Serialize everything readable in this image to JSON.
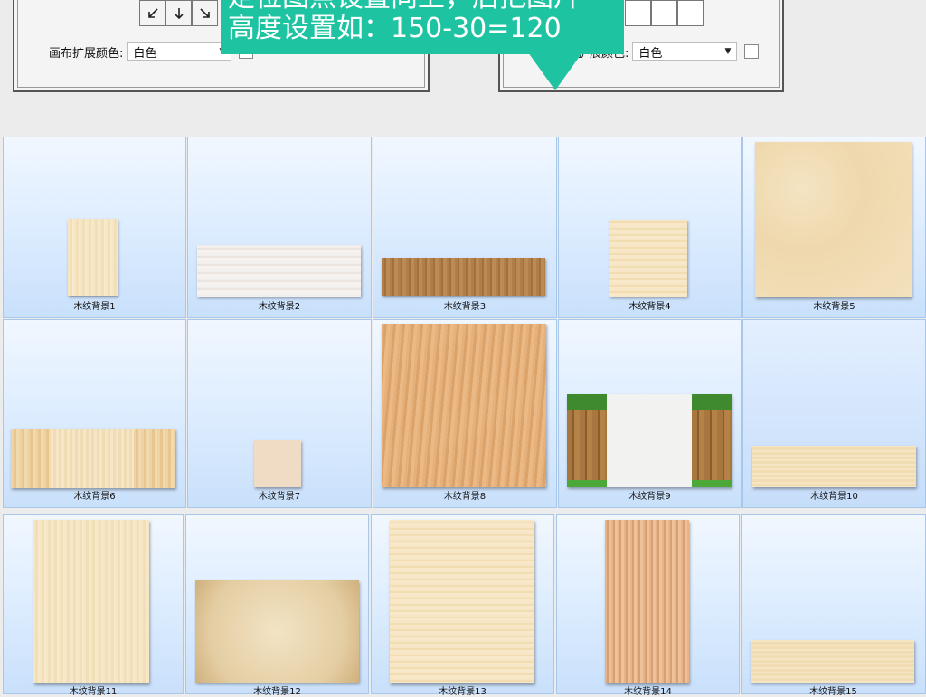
{
  "dialog": {
    "left_panel": {
      "label": "画布扩展颜色:",
      "value": "白色"
    },
    "right_panel": {
      "label": "画布扩展颜色:",
      "value": "白色"
    },
    "anchor_arrows": [
      "arrow-down-left",
      "arrow-down",
      "arrow-down-right"
    ]
  },
  "callout": {
    "line1": "定位图点设置向上，后把图片",
    "line2": "高度设置如：150-30=120"
  },
  "gallery": {
    "items": [
      "木纹背景1",
      "木纹背景2",
      "木纹背景3",
      "木纹背景4",
      "木纹背景5",
      "木纹背景6",
      "木纹背景7",
      "木纹背景8",
      "木纹背景9",
      "木纹背景10",
      "木纹背景11",
      "木纹背景12",
      "木纹背景13",
      "木纹背景14",
      "木纹背景15"
    ]
  },
  "colors": {
    "callout": "#1ec3a1",
    "tile_border": "#a9c7e8",
    "tile_bg": "#dfeeff"
  }
}
